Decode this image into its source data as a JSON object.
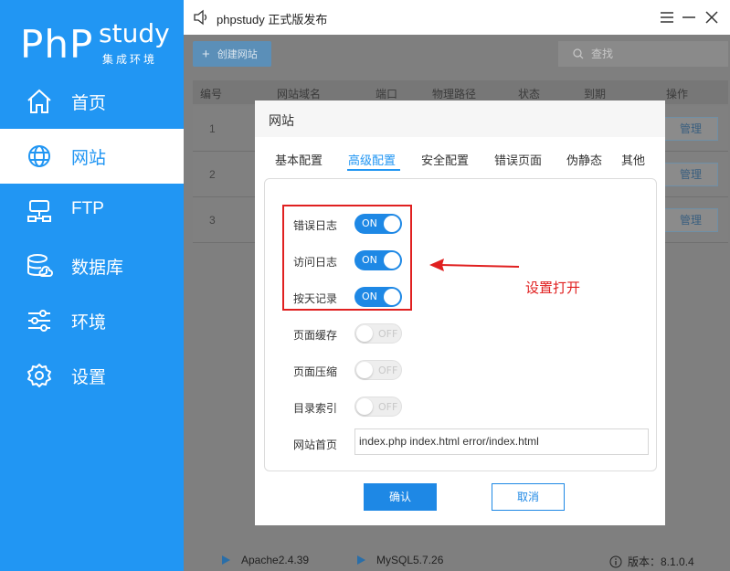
{
  "sidebar": {
    "logo_main": "PhP",
    "logo_study": "study",
    "logo_sub": "集成环境",
    "items": [
      {
        "label": "首页",
        "icon": "home-icon"
      },
      {
        "label": "网站",
        "icon": "globe-icon",
        "active": true
      },
      {
        "label": "FTP",
        "icon": "ftp-icon"
      },
      {
        "label": "数据库",
        "icon": "database-icon"
      },
      {
        "label": "环境",
        "icon": "sliders-icon"
      },
      {
        "label": "设置",
        "icon": "gear-icon"
      }
    ],
    "color": "#2196f3"
  },
  "titlebar": {
    "title": "phpstudy 正式版发布"
  },
  "toolbar": {
    "create_label": "创建网站",
    "search_placeholder": "查找"
  },
  "table": {
    "headers": [
      "编号",
      "网站域名",
      "端口",
      "物理路径",
      "状态",
      "到期",
      "操作"
    ],
    "rows": [
      {
        "num": "1",
        "action": "管理"
      },
      {
        "num": "2",
        "action": "管理"
      },
      {
        "num": "3",
        "action": "管理"
      }
    ]
  },
  "modal": {
    "title": "网站",
    "tabs": [
      "基本配置",
      "高级配置",
      "安全配置",
      "错误页面",
      "伪静态",
      "其他"
    ],
    "active_tab": "高级配置",
    "options": [
      {
        "label": "错误日志",
        "state": "ON"
      },
      {
        "label": "访问日志",
        "state": "ON"
      },
      {
        "label": "按天记录",
        "state": "ON"
      },
      {
        "label": "页面缓存",
        "state": "OFF"
      },
      {
        "label": "页面压缩",
        "state": "OFF"
      },
      {
        "label": "目录索引",
        "state": "OFF"
      }
    ],
    "index_label": "网站首页",
    "index_value": "index.php index.html error/index.html",
    "confirm_label": "确认",
    "cancel_label": "取消"
  },
  "annotation": {
    "text": "设置打开",
    "color": "#e02020"
  },
  "statusbar": {
    "apache": "Apache2.4.39",
    "mysql": "MySQL5.7.26",
    "version": "版本：8.1.0.4"
  }
}
